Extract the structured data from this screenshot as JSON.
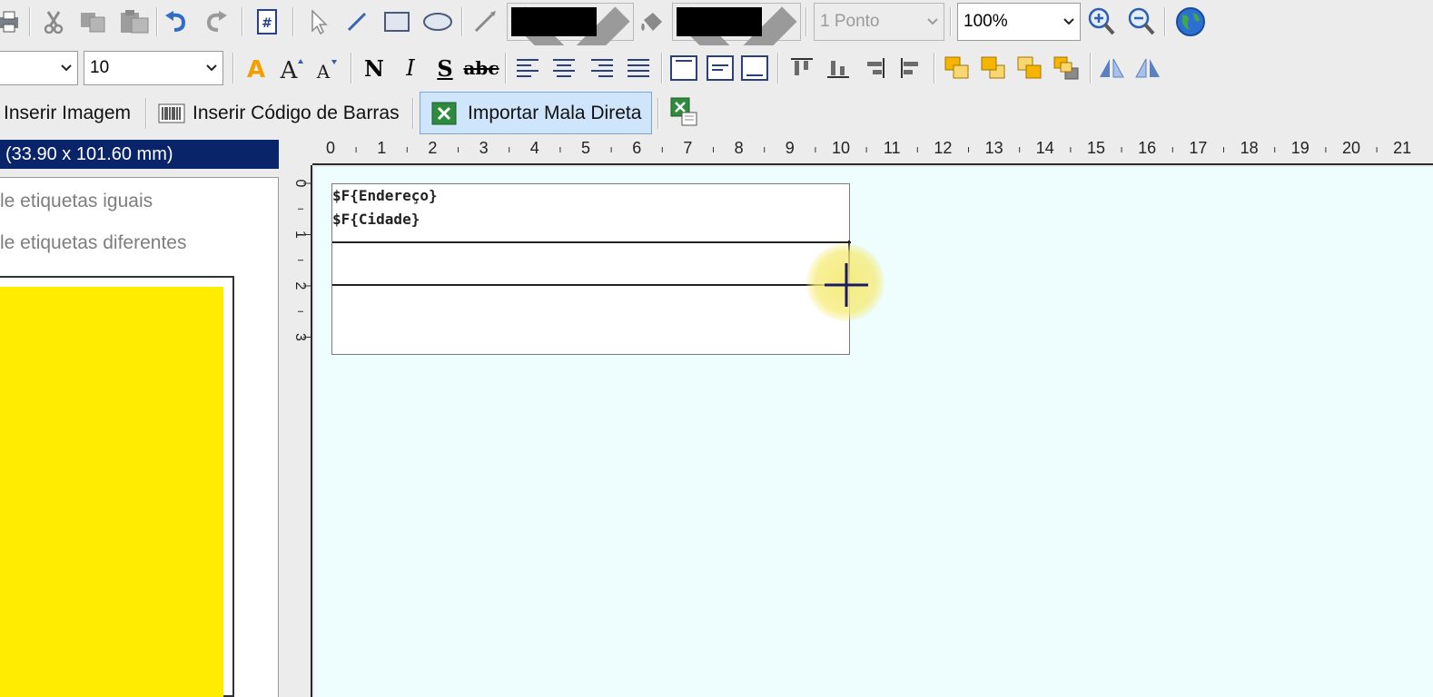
{
  "toolbar1": {
    "line_width_value": "1 Ponto",
    "zoom_value": "100%",
    "line_color": "#000000",
    "fill_color": "#000000"
  },
  "toolbar2": {
    "font_size_value": "10",
    "bold_label": "N",
    "italic_label": "I",
    "underline_label": "S",
    "strike_label": "abc"
  },
  "toolbar3": {
    "insert_image_label": "Inserir Imagem",
    "insert_barcode_label": "Inserir Código de Barras",
    "import_mail_merge_label": "Importar Mala Direta"
  },
  "left_panel": {
    "label_size": "(33.90 x 101.60 mm)",
    "option_equal": "le etiquetas iguais",
    "option_different": "le etiquetas diferentes",
    "preview_color": "#ffec00"
  },
  "ruler": {
    "top_ticks": [
      "0",
      "1",
      "2",
      "3",
      "4",
      "5",
      "6",
      "7",
      "8",
      "9",
      "10",
      "11",
      "12",
      "13",
      "14",
      "15",
      "16",
      "17",
      "18",
      "19",
      "20",
      "21"
    ],
    "left_ticks": [
      "0",
      "1",
      "2",
      "3"
    ]
  },
  "label": {
    "field_address": "$F{Endereço}",
    "field_city": "$F{Cidade}"
  },
  "colors": {
    "canvas_bg": "#eefdfd",
    "selection_bar": "#0a246a",
    "active_button_bg": "#cfe5fb"
  }
}
